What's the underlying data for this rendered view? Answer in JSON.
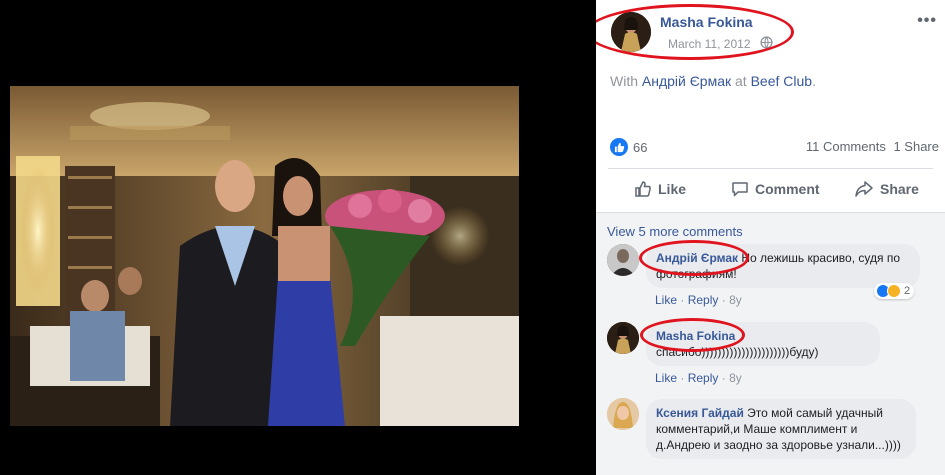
{
  "post": {
    "author": "Masha Fokina",
    "date": "March 11, 2012",
    "with_prefix": "With",
    "with_person": "Андрій Єрмак",
    "at_word": "at",
    "place": "Beef Club",
    "place_suffix": ".",
    "reaction_count": "66",
    "comments_label": "11 Comments",
    "shares_label": "1 Share"
  },
  "actions": {
    "like": "Like",
    "comment": "Comment",
    "share": "Share"
  },
  "view_more": "View 5 more comments",
  "comments": [
    {
      "author": "Андрій Єрмак",
      "text": " Но лежишь красиво, судя по фотографиям!",
      "like": "Like",
      "reply": "Reply",
      "age": "8y",
      "reactions": "2"
    },
    {
      "author": "Masha Fokina",
      "text": "спасибо))))))))))))))))))))))буду)",
      "like": "Like",
      "reply": "Reply",
      "age": "8y"
    },
    {
      "author": "Ксения Гайдай",
      "text": " Это мой самый удачный комментарий,и Маше комплимент и д.Андрею и заодно за здоровье узнали...))))"
    }
  ],
  "colors": {
    "link": "#385898",
    "highlight": "#e0141e",
    "like_blue": "#1877f2"
  }
}
